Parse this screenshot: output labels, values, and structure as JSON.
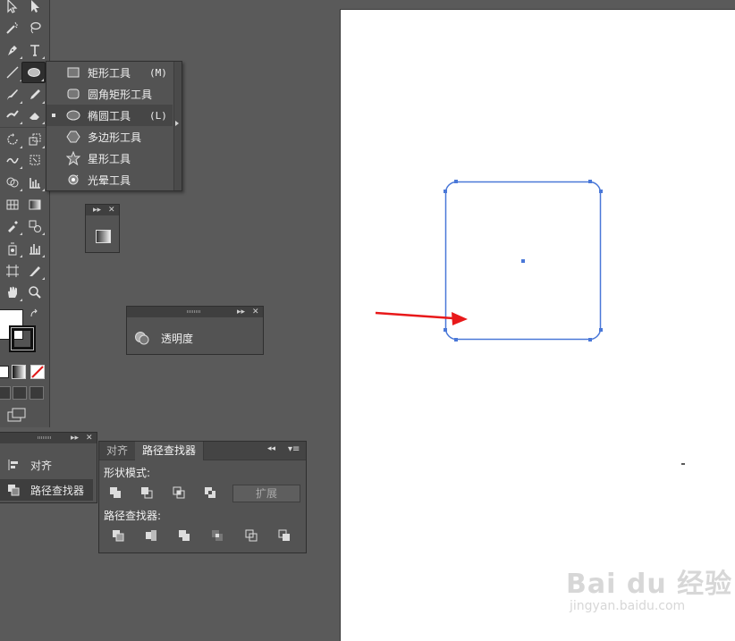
{
  "flyout": {
    "items": [
      {
        "icon": "rectangle-icon",
        "label": "矩形工具",
        "shortcut": "(M)",
        "active": false
      },
      {
        "icon": "rounded-rectangle-icon",
        "label": "圆角矩形工具",
        "shortcut": "",
        "active": false
      },
      {
        "icon": "ellipse-icon",
        "label": "椭圆工具",
        "shortcut": "(L)",
        "active": true
      },
      {
        "icon": "polygon-icon",
        "label": "多边形工具",
        "shortcut": "",
        "active": false
      },
      {
        "icon": "star-icon",
        "label": "星形工具",
        "shortcut": "",
        "active": false
      },
      {
        "icon": "flare-icon",
        "label": "光晕工具",
        "shortcut": "",
        "active": false
      }
    ]
  },
  "transparency_panel": {
    "label": "透明度"
  },
  "left_dock": {
    "items": [
      {
        "label": "对齐"
      },
      {
        "label": "路径查找器"
      }
    ]
  },
  "pathfinder_panel": {
    "tabs": [
      {
        "label": "对齐"
      },
      {
        "label": "路径查找器"
      }
    ],
    "shape_modes_label": "形状模式:",
    "expand_label": "扩展",
    "pathfinders_label": "路径查找器:"
  },
  "watermark": {
    "brand": "Bai du 经验",
    "url": "jingyan.baidu.com"
  },
  "colors": {
    "selection": "#4a78d8",
    "arrow": "#e8191a",
    "ui_bg": "#535353",
    "pasteboard": "#5a5a5a"
  }
}
